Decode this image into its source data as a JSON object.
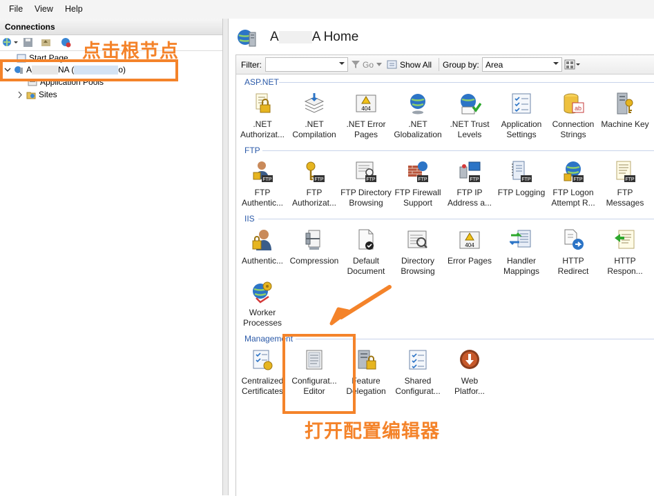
{
  "menu": {
    "file": "File",
    "view": "View",
    "help": "Help"
  },
  "connections": {
    "title": "Connections",
    "tree": {
      "start_page": "Start Page",
      "server_prefix": "A",
      "server_mid": "NA (",
      "server_suffix": "o)",
      "app_pools": "Application Pools",
      "sites": "Sites"
    }
  },
  "home": {
    "title_prefix": "A",
    "title_suffix": "A Home"
  },
  "filterbar": {
    "filter_label": "Filter:",
    "go": "Go",
    "show_all": "Show All",
    "group_by_label": "Group by:",
    "group_by_value": "Area"
  },
  "sections": {
    "aspnet": "ASP.NET",
    "ftp": "FTP",
    "iis": "IIS",
    "management": "Management"
  },
  "features": {
    "aspnet": [
      {
        "l1": ".NET",
        "l2": "Authorizat..."
      },
      {
        "l1": ".NET",
        "l2": "Compilation"
      },
      {
        "l1": ".NET Error",
        "l2": "Pages"
      },
      {
        "l1": ".NET",
        "l2": "Globalization"
      },
      {
        "l1": ".NET Trust",
        "l2": "Levels"
      },
      {
        "l1": "Application",
        "l2": "Settings"
      },
      {
        "l1": "Connection",
        "l2": "Strings"
      },
      {
        "l1": "Machine Key",
        "l2": ""
      }
    ],
    "ftp": [
      {
        "l1": "FTP",
        "l2": "Authentic..."
      },
      {
        "l1": "FTP",
        "l2": "Authorizat..."
      },
      {
        "l1": "FTP Directory",
        "l2": "Browsing"
      },
      {
        "l1": "FTP Firewall",
        "l2": "Support"
      },
      {
        "l1": "FTP IP",
        "l2": "Address a..."
      },
      {
        "l1": "FTP Logging",
        "l2": ""
      },
      {
        "l1": "FTP Logon",
        "l2": "Attempt R..."
      },
      {
        "l1": "FTP",
        "l2": "Messages"
      }
    ],
    "iis": [
      {
        "l1": "Authentic...",
        "l2": ""
      },
      {
        "l1": "Compression",
        "l2": ""
      },
      {
        "l1": "Default",
        "l2": "Document"
      },
      {
        "l1": "Directory",
        "l2": "Browsing"
      },
      {
        "l1": "Error Pages",
        "l2": ""
      },
      {
        "l1": "Handler",
        "l2": "Mappings"
      },
      {
        "l1": "HTTP",
        "l2": "Redirect"
      },
      {
        "l1": "HTTP",
        "l2": "Respon..."
      }
    ],
    "iis2": [
      {
        "l1": "Worker",
        "l2": "Processes"
      }
    ],
    "management": [
      {
        "l1": "Centralized",
        "l2": "Certificates"
      },
      {
        "l1": "Configurat...",
        "l2": "Editor"
      },
      {
        "l1": "Feature",
        "l2": "Delegation"
      },
      {
        "l1": "Shared",
        "l2": "Configurat..."
      },
      {
        "l1": "Web",
        "l2": "Platfor..."
      }
    ]
  },
  "annotations": {
    "click_root": "点击根节点",
    "open_editor": "打开配置编辑器"
  },
  "colors": {
    "annotation": "#f4832a",
    "section": "#2a59a8"
  }
}
